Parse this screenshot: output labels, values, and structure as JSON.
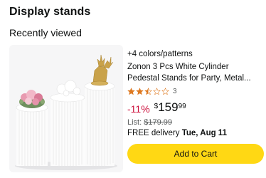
{
  "section": {
    "title": "Display stands"
  },
  "recently_viewed": {
    "title": "Recently viewed"
  },
  "product": {
    "variants": "+4 colors/patterns",
    "title_line1": "Zonon 3 Pcs White Cylinder",
    "title_line2": "Pedestal Stands for Party, Metal...",
    "rating": 2.5,
    "rating_count": "3",
    "discount": "-11%",
    "price_symbol": "$",
    "price_whole": "159",
    "price_fraction": "99",
    "list_label": "List:",
    "list_price": "$179.99",
    "delivery_prefix": "FREE delivery",
    "delivery_date": "Tue, Aug 11",
    "add_to_cart": "Add to Cart"
  },
  "colors": {
    "button": "#ffd814",
    "discount": "#cc0c39",
    "star": "#de7921",
    "muted": "#565959"
  }
}
